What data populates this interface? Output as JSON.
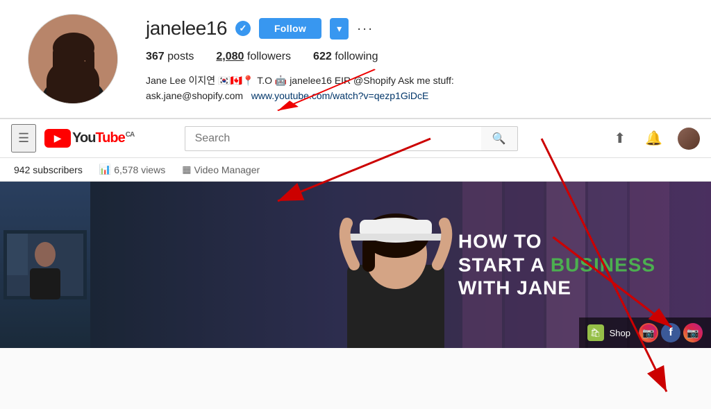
{
  "instagram": {
    "username": "janelee16",
    "verified": true,
    "follow_button": "Follow",
    "stats": {
      "posts": "367",
      "posts_label": "posts",
      "followers": "2,080",
      "followers_label": "followers",
      "following": "622",
      "following_label": "following"
    },
    "bio": {
      "line1": "Jane Lee 이지연 🇰🇷🇨🇦📍 T.O 🤖 janelee16 EIR @Shopify Ask me stuff:",
      "line2": "ask.jane@shopify.com",
      "link_text": "www.youtube.com/watch?v=qezp1GiDcE"
    }
  },
  "youtube": {
    "logo_text": "You",
    "logo_text2": "Tube",
    "country": "CA",
    "search_placeholder": "Search",
    "channel": {
      "subscribers": "942 subscribers",
      "views": "6,578 views",
      "video_manager": "Video Manager"
    },
    "video": {
      "title_line1": "HOW TO",
      "title_line2_normal": "START A ",
      "title_line2_highlight": "BUSINESS",
      "title_line3": "WITH JANE"
    },
    "bottom": {
      "shop_label": "Shop",
      "social_icons": [
        "instagram",
        "facebook",
        "instagram"
      ]
    }
  }
}
